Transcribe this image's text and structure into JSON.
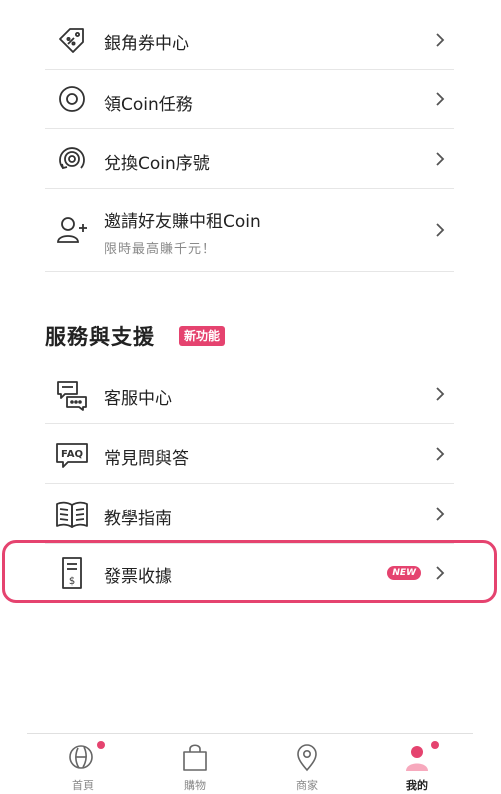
{
  "menu_top": [
    {
      "icon": "coupon-tag-icon",
      "label": "銀角券中心"
    },
    {
      "icon": "coin-icon",
      "label": "領Coin任務"
    },
    {
      "icon": "coin-exchange-icon",
      "label": "兌換Coin序號"
    },
    {
      "icon": "invite-user-icon",
      "label": "邀請好友賺中租Coin",
      "sub": "限時最高賺千元！"
    }
  ],
  "support_section": {
    "title": "服務與支援",
    "badge": "新功能",
    "items": [
      {
        "icon": "chat-bubbles-icon",
        "label": "客服中心"
      },
      {
        "icon": "faq-icon",
        "label": "常見問與答",
        "icon_text": "FAQ"
      },
      {
        "icon": "book-icon",
        "label": "教學指南"
      },
      {
        "icon": "receipt-icon",
        "label": "發票收據",
        "pill": "NEW"
      }
    ]
  },
  "tabbar": {
    "items": [
      {
        "icon": "home-logo-icon",
        "label": "首頁",
        "active": false,
        "dot": true
      },
      {
        "icon": "shopping-bag-icon",
        "label": "購物",
        "active": false,
        "dot": false
      },
      {
        "icon": "map-pin-icon",
        "label": "商家",
        "active": false,
        "dot": false
      },
      {
        "icon": "user-icon",
        "label": "我的",
        "active": true,
        "dot": true
      }
    ]
  },
  "colors": {
    "accent": "#e5436f",
    "text": "#222222",
    "icon_stroke": "#333333",
    "divider": "#e6e6e6"
  }
}
